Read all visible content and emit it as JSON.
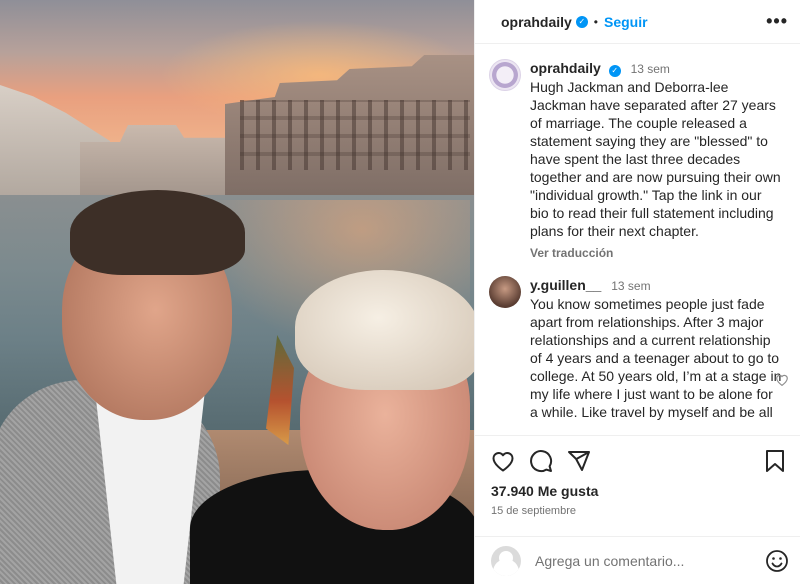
{
  "post": {
    "username": "oprahdaily",
    "verified_mark": "✓",
    "separator": "•",
    "follow_label": "Seguir",
    "more_label": "•••"
  },
  "caption": {
    "username": "oprahdaily",
    "time": "13 sem",
    "text": "Hugh Jackman and Deborra-lee Jackman have separated after 27 years of marriage. The couple released a statement saying they are \"blessed\" to have spent the last three decades together and are now pursuing their own \"individual growth.\" Tap the link in our bio to read their full statement including plans for their next chapter.",
    "translate_label": "Ver traducción"
  },
  "comment": {
    "username": "y.guillen__",
    "time": "13 sem",
    "text": "You know sometimes people just fade apart from relationships. After 3 major relationships and a current relationship of 4 years and a teenager about to go to college. At 50 years old, I’m at a stage in my life where I just want to be alone for a while. Like travel by myself and be all"
  },
  "stats": {
    "likes": "37.940 Me gusta",
    "date": "15 de septiembre"
  },
  "add_comment": {
    "placeholder": "Agrega un comentario..."
  },
  "icons": [
    "heart-icon",
    "comment-icon",
    "share-icon",
    "bookmark-icon",
    "emoji-icon",
    "more-icon"
  ],
  "colors": {
    "accent": "#0095f6",
    "text": "#262626",
    "muted": "#737373"
  }
}
